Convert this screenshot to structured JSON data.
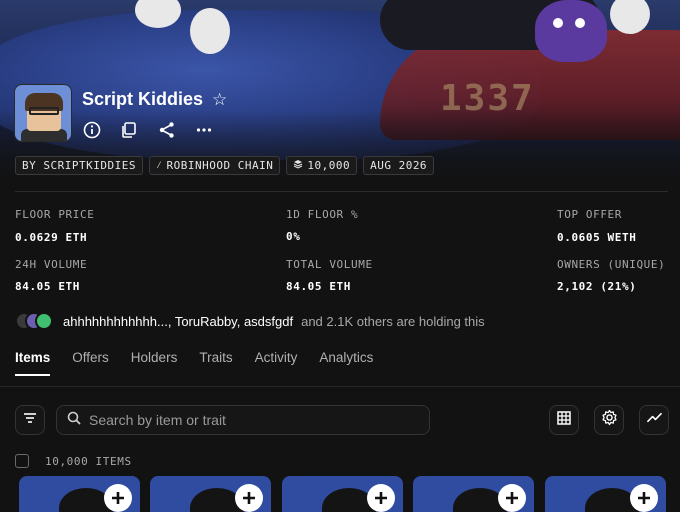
{
  "collection": {
    "name": "Script Kiddies",
    "tags": [
      {
        "label": "BY SCRIPTKIDDIES",
        "icon": ""
      },
      {
        "label": "ROBINHOOD CHAIN",
        "icon": "feather-icon"
      },
      {
        "label": "10,000",
        "icon": "layers-icon"
      },
      {
        "label": "AUG 2026",
        "icon": ""
      }
    ],
    "banner_number": "1337"
  },
  "stats": [
    {
      "label": "FLOOR PRICE",
      "value": "0.0629 ETH"
    },
    {
      "label": "1D FLOOR %",
      "value": "0%"
    },
    {
      "label": "TOP OFFER",
      "value": "0.0605 WETH"
    },
    {
      "label": "24H VOLUME",
      "value": "84.05 ETH"
    },
    {
      "label": "TOTAL VOLUME",
      "value": "84.05 ETH"
    },
    {
      "label": "OWNERS (UNIQUE)",
      "value": "2,102 (21%)"
    }
  ],
  "holders": {
    "names": "ahhhhhhhhhhhh..., ToruRabby, asdsfgdf",
    "others": "and 2.1K others are holding this"
  },
  "tabs": [
    "Items",
    "Offers",
    "Holders",
    "Traits",
    "Activity",
    "Analytics"
  ],
  "search": {
    "placeholder": "Search by item or trait"
  },
  "items_count": "10,000 ITEMS",
  "colors": {
    "background": "#121212",
    "card": "#2f4ca0",
    "border": "#333333",
    "muted_text": "#a8a8a8"
  }
}
